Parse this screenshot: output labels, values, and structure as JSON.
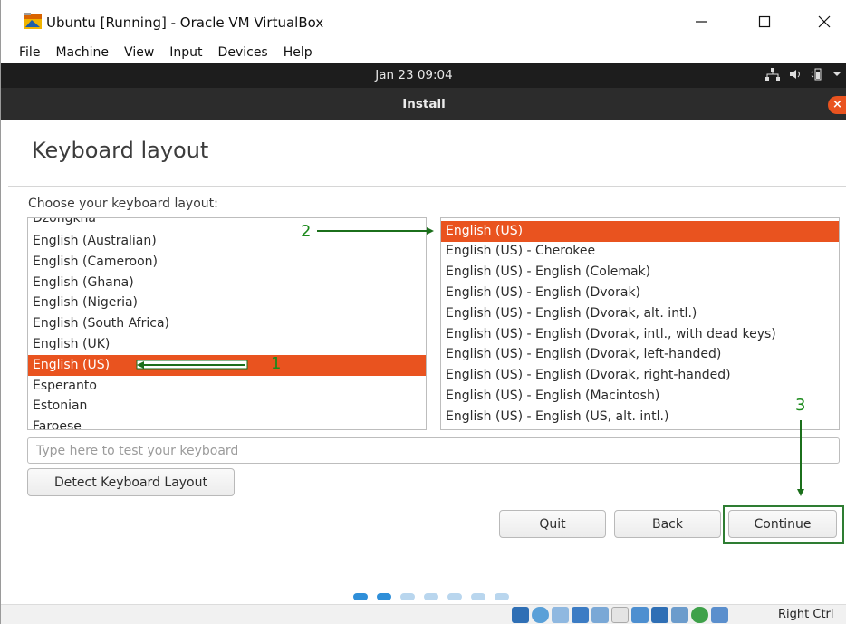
{
  "host": {
    "title": "Ubuntu [Running] - Oracle VM VirtualBox",
    "menu": [
      "File",
      "Machine",
      "View",
      "Input",
      "Devices",
      "Help"
    ],
    "status_hostkey": "Right Ctrl"
  },
  "guest": {
    "clock": "Jan 23  09:04",
    "installer_title": "Install"
  },
  "page": {
    "title": "Keyboard layout",
    "prompt": "Choose your keyboard layout:",
    "layouts": [
      "Dzongkha",
      "English (Australian)",
      "English (Cameroon)",
      "English (Ghana)",
      "English (Nigeria)",
      "English (South Africa)",
      "English (UK)",
      "English (US)",
      "Esperanto",
      "Estonian",
      "Faroese"
    ],
    "selected_layout": "English (US)",
    "variants": [
      "English (US)",
      "English (US) - Cherokee",
      "English (US) - English (Colemak)",
      "English (US) - English (Dvorak)",
      "English (US) - English (Dvorak, alt. intl.)",
      "English (US) - English (Dvorak, intl., with dead keys)",
      "English (US) - English (Dvorak, left-handed)",
      "English (US) - English (Dvorak, right-handed)",
      "English (US) - English (Macintosh)",
      "English (US) - English (US, alt. intl.)"
    ],
    "selected_variant": "English (US)",
    "test_placeholder": "Type here to test your keyboard",
    "detect_label": "Detect Keyboard Layout",
    "quit_label": "Quit",
    "back_label": "Back",
    "continue_label": "Continue"
  },
  "annotations": {
    "one": "1",
    "two": "2",
    "three": "3",
    "color": "#1b8a1b"
  },
  "progress": {
    "total_steps": 7,
    "current_step": 2
  },
  "colors": {
    "accent": "#e9531f",
    "annotation": "#2e7d32",
    "progress_active": "#2f8fd9",
    "progress_inactive": "#b9d6ee"
  }
}
